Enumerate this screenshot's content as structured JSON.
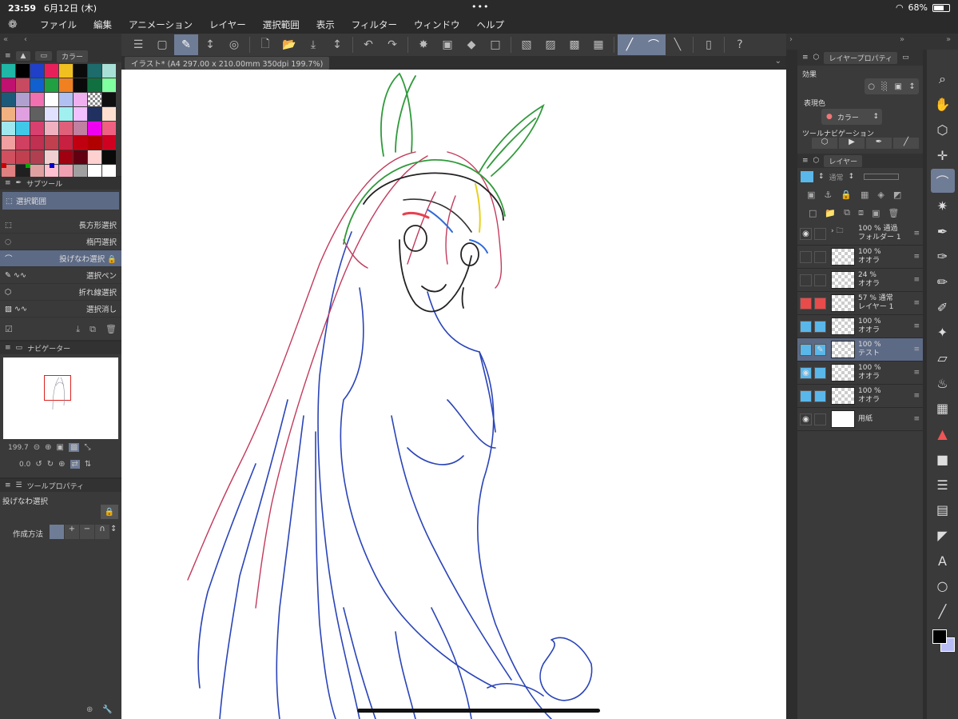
{
  "status": {
    "time": "23:59",
    "date": "6月12日 (木)",
    "battery": "68%",
    "battery_level": 0.68
  },
  "menu": [
    "ファイル",
    "編集",
    "アニメーション",
    "レイヤー",
    "選択範囲",
    "表示",
    "フィルター",
    "ウィンドウ",
    "ヘルプ"
  ],
  "canvas_tab": "イラスト* (A4 297.00 x 210.00mm 350dpi 199.7%)",
  "color_panel": {
    "tab": "カラー"
  },
  "subtool": {
    "title": "サブツール",
    "group": "選択範囲",
    "items": [
      "長方形選択",
      "楕円選択",
      "投げなわ選択",
      "選択ペン",
      "折れ線選択",
      "選択消し"
    ],
    "selected_index": 2
  },
  "navigator": {
    "title": "ナビゲーター",
    "zoom": "199.7",
    "rotation": "0.0"
  },
  "tool_property": {
    "title": "ツールプロパティ",
    "tool_name": "投げなわ選択",
    "method_label": "作成方法"
  },
  "layer_property": {
    "title": "レイヤープロパティ",
    "effect": "効果",
    "expression_color": "表現色",
    "color_mode": "カラー",
    "tool_navigation": "ツールナビゲーション"
  },
  "layers_panel": {
    "title": "レイヤー",
    "blend": "通常",
    "layers": [
      {
        "line1": "100 %  通過",
        "line2": "フォルダー 1",
        "eye": true,
        "folder": true,
        "color": ""
      },
      {
        "line1": "100 %",
        "line2": "オオラ",
        "eye": false,
        "color": ""
      },
      {
        "line1": "24 %",
        "line2": "オオラ",
        "eye": false,
        "color": ""
      },
      {
        "line1": "57 %  通常",
        "line2": "レイヤー 1",
        "eye": false,
        "color": "#e94b4b"
      },
      {
        "line1": "100 %",
        "line2": "オオラ",
        "eye": false,
        "color": "#5ab7ea"
      },
      {
        "line1": "100 %",
        "line2": "テスト",
        "eye": false,
        "color": "#5ab7ea",
        "selected": true
      },
      {
        "line1": "100 %",
        "line2": "オオラ",
        "eye": true,
        "color": "#5ab7ea"
      },
      {
        "line1": "100 %",
        "line2": "オオラ",
        "eye": false,
        "color": "#5ab7ea"
      },
      {
        "line1": "",
        "line2": "用紙",
        "eye": true,
        "color": ""
      }
    ]
  },
  "palette": [
    "#1fb7a6",
    "#000000",
    "#2040c8",
    "#e8205a",
    "#f0c020",
    "#0b0b0b",
    "#1d6b6b",
    "#a8e0d8",
    "#c01070",
    "#c84a60",
    "#1060d0",
    "#20a040",
    "#f08020",
    "#0a0a0a",
    "#107040",
    "#80ffa0",
    "#1c5a7a",
    "#b0a0d0",
    "#f070b0",
    "#ffffff",
    "#b0c0f0",
    "#f0b0f0",
    "#checker",
    "#101010",
    "#f0b080",
    "#e0a0e0",
    "#606060",
    "#e0e0ff",
    "#a0f0f0",
    "#f0c0ff",
    "#203060",
    "#ffe0d0",
    "#a0e8f0",
    "#40c8e8",
    "#d84070",
    "#f0b0c0",
    "#e0607a",
    "#c080a0",
    "#f000f0",
    "#f06080",
    "#f0a0a0",
    "#d04060",
    "#c03050",
    "#c04050",
    "#c82040",
    "#c00010",
    "#b00000",
    "#d00020",
    "#d05060",
    "#c04050",
    "#b04050",
    "#f0d0d0",
    "#a00010",
    "#600010",
    "#ffd0d0",
    "#0a0a0a",
    "#e08080",
    "#202020",
    "#e0a0a0",
    "#ffc0d0",
    "#f0a0b0",
    "#a0a0a0",
    "#ffffff",
    "#ffffff"
  ]
}
